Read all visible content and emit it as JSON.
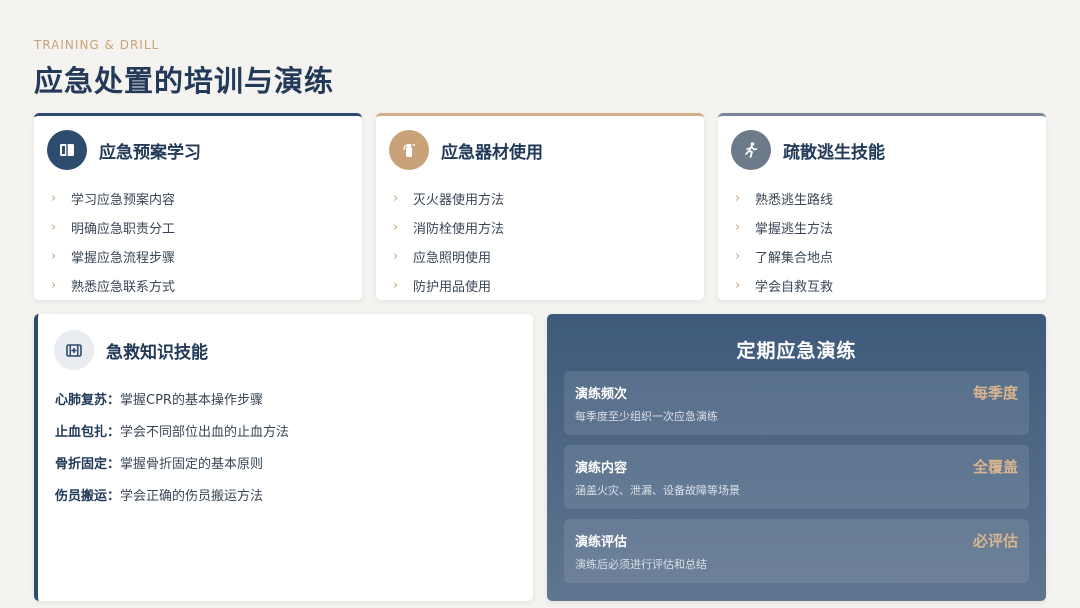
{
  "header": {
    "eyebrow": "TRAINING & DRILL",
    "title": "应急处置的培训与演练"
  },
  "cards": [
    {
      "icon": "book-icon",
      "title": "应急预案学习",
      "accent": "#2e4d6e",
      "items": [
        "学习应急预案内容",
        "明确应急职责分工",
        "掌握应急流程步骤",
        "熟悉应急联系方式"
      ]
    },
    {
      "icon": "fire-extinguisher-icon",
      "title": "应急器材使用",
      "accent": "#c9a27a",
      "items": [
        "灭火器使用方法",
        "消防栓使用方法",
        "应急照明使用",
        "防护用品使用"
      ]
    },
    {
      "icon": "running-person-icon",
      "title": "疏散逃生技能",
      "accent": "#6d7a8a",
      "items": [
        "熟悉逃生路线",
        "掌握逃生方法",
        "了解集合地点",
        "学会自救互救"
      ]
    }
  ],
  "first_aid": {
    "icon": "first-aid-kit-icon",
    "title": "急救知识技能",
    "rows": [
      {
        "key": "心肺复苏：",
        "text": "掌握CPR的基本操作步骤"
      },
      {
        "key": "止血包扎：",
        "text": "学会不同部位出血的止血方法"
      },
      {
        "key": "骨折固定：",
        "text": "掌握骨折固定的基本原则"
      },
      {
        "key": "伤员搬运：",
        "text": "学会正确的伤员搬运方法"
      }
    ]
  },
  "drill": {
    "title": "定期应急演练",
    "items": [
      {
        "label": "演练频次",
        "desc": "每季度至少组织一次应急演练",
        "badge": "每季度"
      },
      {
        "label": "演练内容",
        "desc": "涵盖火灾、泄漏、设备故障等场景",
        "badge": "全覆盖"
      },
      {
        "label": "演练评估",
        "desc": "演练后必须进行评估和总结",
        "badge": "必评估"
      }
    ]
  }
}
